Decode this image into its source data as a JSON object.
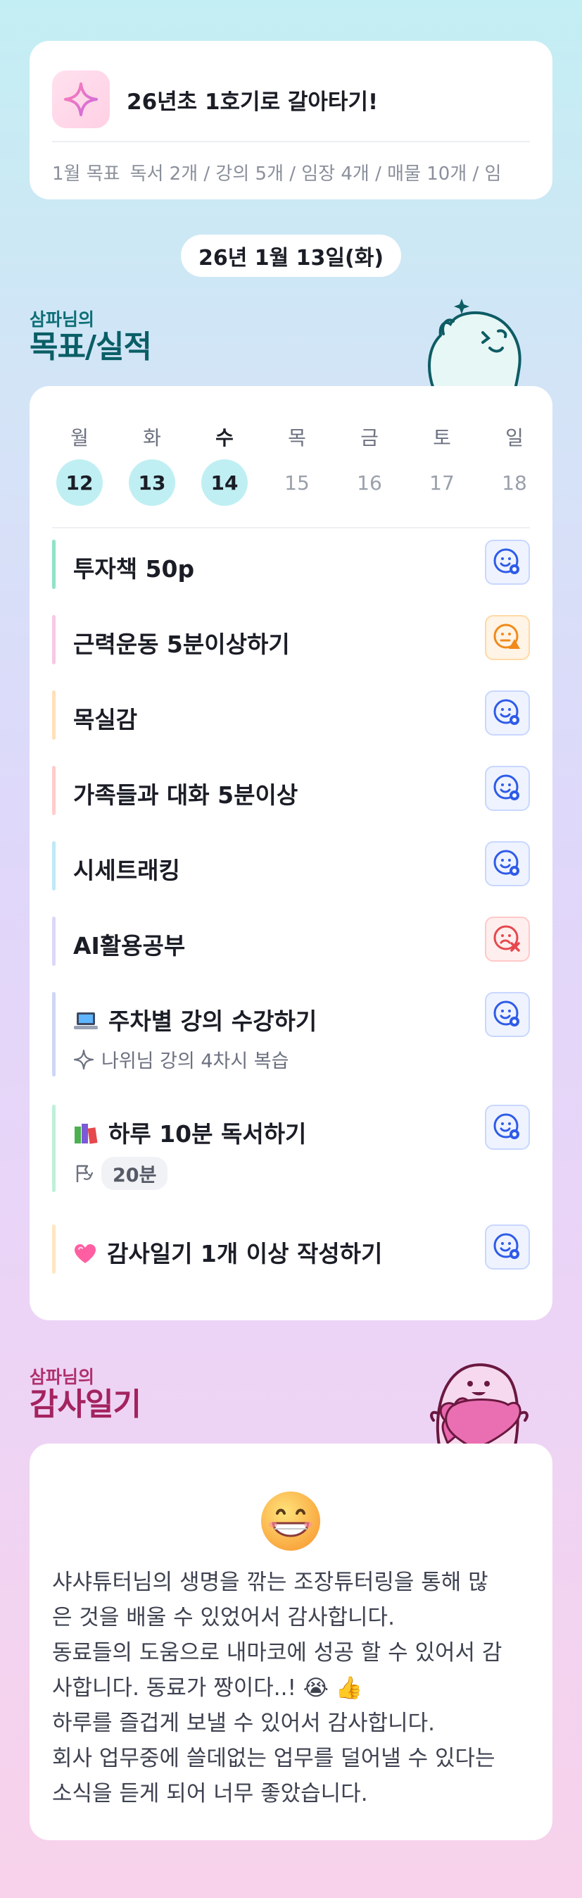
{
  "goal_card": {
    "title": "26년초 1호기로 갈아타기!",
    "month_label": "1월 목표",
    "targets": "독서 2개 / 강의 5개 / 임장 4개 / 매물 10개 / 임"
  },
  "date": "26년 1월 13일(화)",
  "goals_section": {
    "kicker": "삼파님의",
    "title": "목표/실적"
  },
  "week": [
    {
      "day": "월",
      "num": "12",
      "active": true,
      "today": false
    },
    {
      "day": "화",
      "num": "13",
      "active": true,
      "today": false
    },
    {
      "day": "수",
      "num": "14",
      "active": true,
      "today": true
    },
    {
      "day": "목",
      "num": "15",
      "active": false,
      "today": false
    },
    {
      "day": "금",
      "num": "16",
      "active": false,
      "today": false
    },
    {
      "day": "토",
      "num": "17",
      "active": false,
      "today": false
    },
    {
      "day": "일",
      "num": "18",
      "active": false,
      "today": false
    }
  ],
  "goals": [
    {
      "label": "투자책 50p",
      "status": "ok",
      "bar_color": "#8fe3c8"
    },
    {
      "label": "근력운동 5분이상하기",
      "status": "warn",
      "bar_color": "#f7c8e6"
    },
    {
      "label": "목실감",
      "status": "ok",
      "bar_color": "#ffe0b8"
    },
    {
      "label": "가족들과 대화 5분이상",
      "status": "ok",
      "bar_color": "#ffcccc"
    },
    {
      "label": "시세트래킹",
      "status": "ok",
      "bar_color": "#bfe9f5"
    },
    {
      "label": "AI활용공부",
      "status": "fail",
      "bar_color": "#dcd8f8"
    },
    {
      "label": "주차별 강의 수강하기",
      "status": "ok",
      "bar_color": "#cfd6f5",
      "icon": "laptop-icon",
      "sub": "나위님 강의 4차시 복습"
    },
    {
      "label": "하루 10분 독서하기",
      "status": "ok",
      "bar_color": "#bff0da",
      "icon": "books-icon",
      "chip": "20분"
    },
    {
      "label": "감사일기 1개 이상 작성하기",
      "status": "ok",
      "bar_color": "#ffe6c2",
      "icon": "heart-icon"
    }
  ],
  "diary_section": {
    "kicker": "삼파님의",
    "title": "감사일기"
  },
  "diary": {
    "lines": [
      "샤샤튜터님의 생명을 깎는 조장튜터링을 통해 많",
      "은 것을 배울 수 있었어서 감사합니다.",
      "동료들의 도움으로 내마코에 성공 할 수 있어서 감",
      "사합니다. 동료가 짱이다..! 😭 👍",
      "하루를 즐겁게 보낼 수 있어서 감사합니다.",
      "회사 업무중에 쓸데없는 업무를 덜어낼 수 있다는",
      "소식을 듣게 되어 너무 좋았습니다."
    ]
  },
  "colors": {
    "accent_teal": "#0a5e66",
    "accent_pink": "#a3235f",
    "status_ok": "#2f5be8",
    "status_warn": "#f08a1c",
    "status_fail": "#e5484d"
  }
}
